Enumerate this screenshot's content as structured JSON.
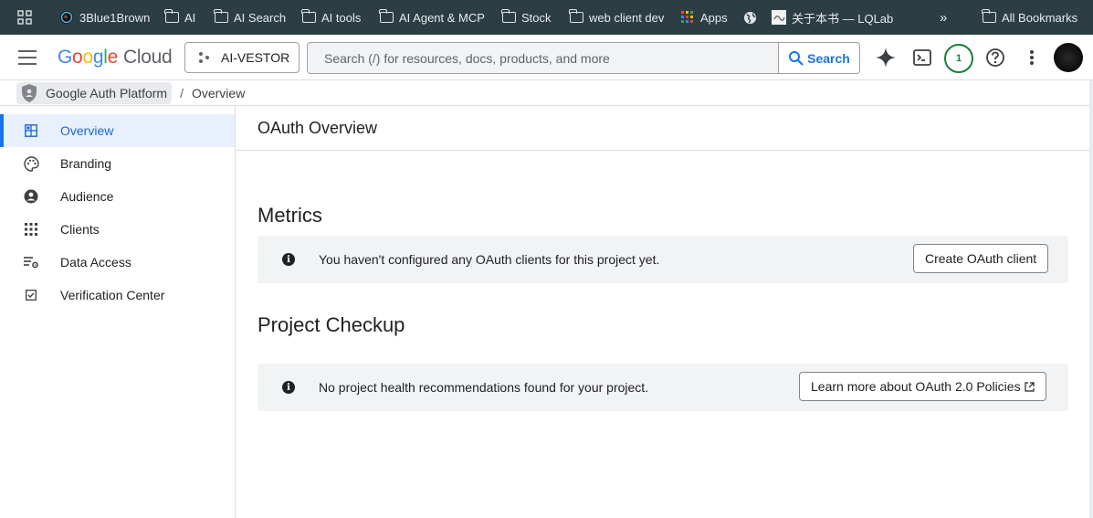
{
  "bookmarks": {
    "items": [
      {
        "label": "3Blue1Brown",
        "icon": "circle-logo-icon"
      },
      {
        "label": "AI",
        "icon": "folder-icon"
      },
      {
        "label": "AI Search",
        "icon": "folder-icon"
      },
      {
        "label": "AI tools",
        "icon": "folder-icon"
      },
      {
        "label": "AI Agent & MCP",
        "icon": "folder-icon"
      },
      {
        "label": "Stock",
        "icon": "folder-icon"
      },
      {
        "label": "web client dev",
        "icon": "folder-icon"
      },
      {
        "label": "Apps",
        "icon": "apps-grid-icon"
      },
      {
        "label": "",
        "icon": "globe-icon"
      },
      {
        "label": "关于本书 — LQLab",
        "icon": "site-favicon-icon"
      }
    ],
    "overflow": "»",
    "all_bookmarks": "All Bookmarks"
  },
  "header": {
    "logo": {
      "google": "Google",
      "cloud": "Cloud"
    },
    "project": "AI-VESTOR",
    "search_placeholder": "Search (/) for resources, docs, products, and more",
    "search_button": "Search",
    "notifications_count": "1"
  },
  "breadcrumb": {
    "product": "Google Auth Platform",
    "separator": "/",
    "current": "Overview"
  },
  "sidebar": {
    "items": [
      {
        "label": "Overview",
        "icon": "dashboard-icon",
        "active": true
      },
      {
        "label": "Branding",
        "icon": "palette-icon"
      },
      {
        "label": "Audience",
        "icon": "person-icon"
      },
      {
        "label": "Clients",
        "icon": "apps-grid-icon"
      },
      {
        "label": "Data Access",
        "icon": "data-settings-icon"
      },
      {
        "label": "Verification Center",
        "icon": "checkbox-icon"
      }
    ]
  },
  "main": {
    "title": "OAuth Overview",
    "metrics": {
      "heading": "Metrics",
      "message": "You haven't configured any OAuth clients for this project yet.",
      "button": "Create OAuth client"
    },
    "checkup": {
      "heading": "Project Checkup",
      "message": "No project health recommendations found for your project.",
      "button": "Learn more about OAuth 2.0 Policies"
    }
  },
  "colors": {
    "accent": "#1a73e8",
    "bookmarks_bar": "#2c3e44",
    "badge": "#188038"
  }
}
